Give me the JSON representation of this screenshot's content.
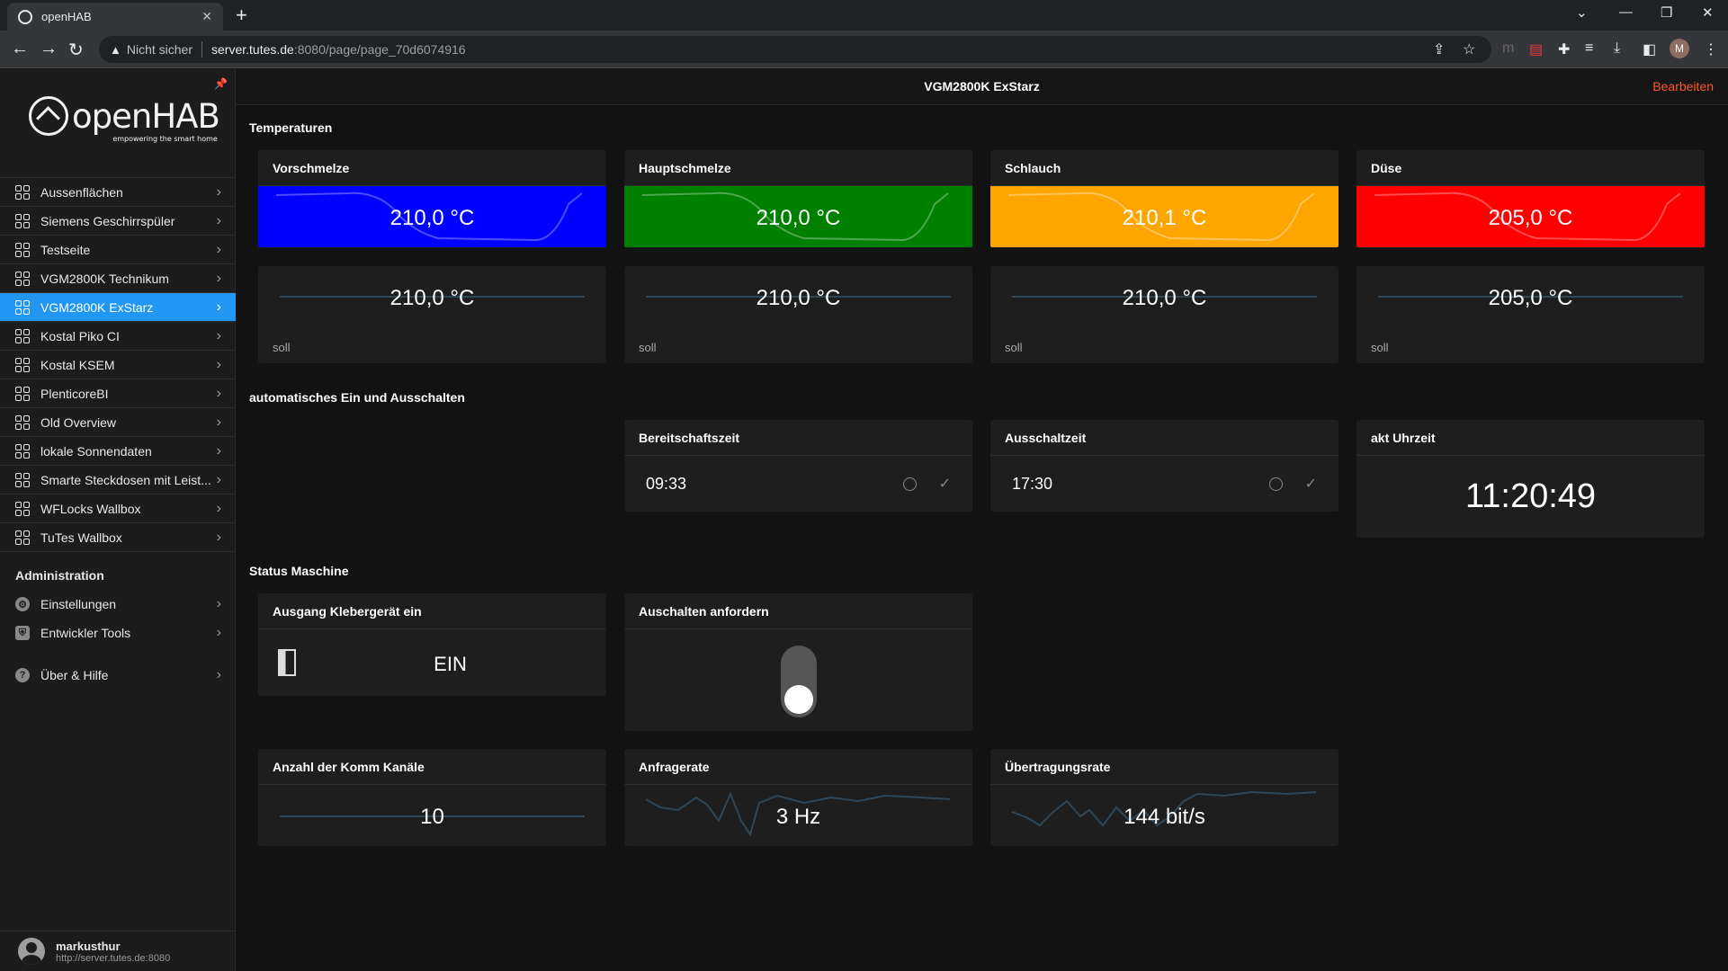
{
  "browser": {
    "tab_title": "openHAB",
    "not_secure": "Nicht sicher",
    "url_host": "server.tutes.de",
    "url_path": ":8080/page/page_70d6074916",
    "profile_initial": "M"
  },
  "sidebar": {
    "logo_text": "openHAB",
    "logo_sub": "empowering the smart home",
    "items": [
      {
        "label": "Aussenflächen"
      },
      {
        "label": "Siemens Geschirrspüler"
      },
      {
        "label": "Testseite"
      },
      {
        "label": "VGM2800K Technikum"
      },
      {
        "label": "VGM2800K ExStarz"
      },
      {
        "label": "Kostal Piko CI"
      },
      {
        "label": "Kostal KSEM"
      },
      {
        "label": "PlenticoreBI"
      },
      {
        "label": "Old Overview"
      },
      {
        "label": "lokale Sonnendaten"
      },
      {
        "label": "Smarte Steckdosen mit Leist..."
      },
      {
        "label": "WFLocks Wallbox"
      },
      {
        "label": "TuTes Wallbox"
      }
    ],
    "admin_title": "Administration",
    "admin_items": [
      {
        "label": "Einstellungen"
      },
      {
        "label": "Entwickler Tools"
      },
      {
        "label": "Über & Hilfe"
      }
    ],
    "user_name": "markusthur",
    "user_url": "http://server.tutes.de:8080"
  },
  "header": {
    "title": "VGM2800K ExStarz",
    "edit_label": "Bearbeiten"
  },
  "sections": {
    "temperatures": "Temperaturen",
    "auto": "automatisches Ein und Ausschalten",
    "status": "Status Maschine"
  },
  "temp_cards": [
    {
      "title": "Vorschmelze",
      "value": "210,0 °C",
      "color": "#0000ff",
      "soll_value": "210,0 °C",
      "soll_label": "soll"
    },
    {
      "title": "Hauptschmelze",
      "value": "210,0 °C",
      "color": "#008000",
      "soll_value": "210,0 °C",
      "soll_label": "soll"
    },
    {
      "title": "Schlauch",
      "value": "210,1 °C",
      "color": "#ffa500",
      "soll_value": "210,0 °C",
      "soll_label": "soll"
    },
    {
      "title": "Düse",
      "value": "205,0 °C",
      "color": "#ff0000",
      "soll_value": "205,0 °C",
      "soll_label": "soll"
    }
  ],
  "auto_cards": {
    "standby": {
      "title": "Bereitschaftszeit",
      "value": "09:33"
    },
    "off": {
      "title": "Ausschaltzeit",
      "value": "17:30"
    },
    "clock": {
      "title": "akt Uhrzeit",
      "value": "11:20:49"
    }
  },
  "status_cards": {
    "output": {
      "title": "Ausgang Klebergerät ein",
      "value": "EIN"
    },
    "shutdown": {
      "title": "Auschalten anfordern",
      "toggle_on": false
    },
    "channels": {
      "title": "Anzahl der Komm Kanäle",
      "value": "10"
    },
    "rate": {
      "title": "Anfragerate",
      "value": "3 Hz"
    },
    "transfer": {
      "title": "Übertragungsrate",
      "value": "144 bit/s"
    }
  }
}
